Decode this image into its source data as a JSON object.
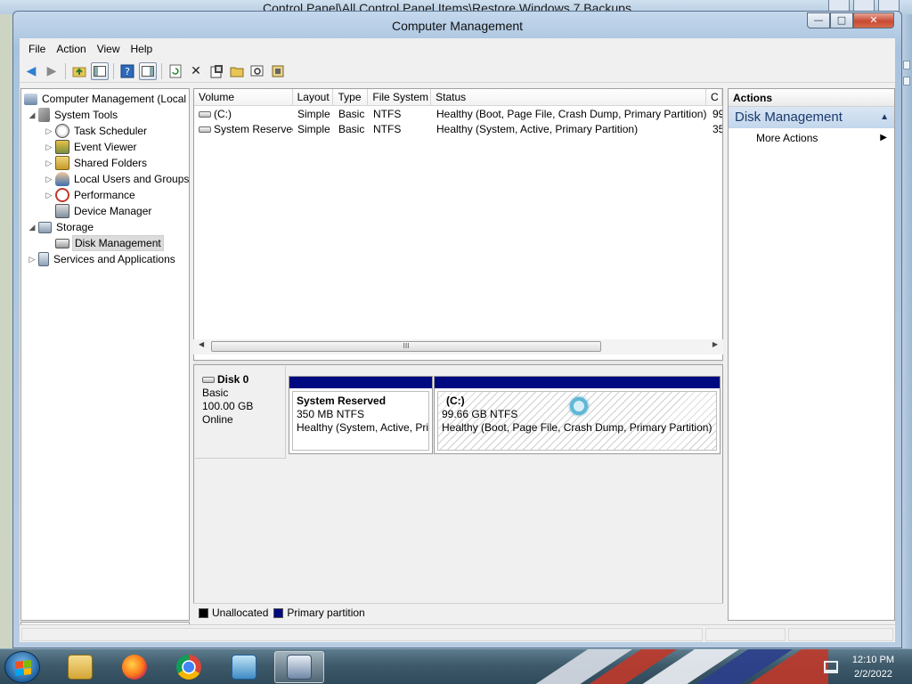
{
  "background_window": {
    "title": "Control Panel\\All Control Panel Items\\Restore Windows 7 Backups"
  },
  "window": {
    "title": "Computer Management",
    "caption_buttons": {
      "minimize": "—",
      "maximize": "□",
      "close": "✕"
    }
  },
  "menu": [
    "File",
    "Action",
    "View",
    "Help"
  ],
  "toolbar_icons": [
    "back-icon",
    "forward-icon",
    "up-folder-icon",
    "show-hide-console-tree-icon",
    "help-icon",
    "show-hide-action-pane-icon",
    "refresh-icon",
    "delete-icon",
    "properties-icon",
    "open-icon",
    "search-icon",
    "disk-properties-icon"
  ],
  "tree": {
    "items": [
      {
        "label": "Computer Management (Local",
        "level": 0,
        "expander": ""
      },
      {
        "label": "System Tools",
        "level": 1,
        "expander": "◢"
      },
      {
        "label": "Task Scheduler",
        "level": 2,
        "expander": "▷"
      },
      {
        "label": "Event Viewer",
        "level": 2,
        "expander": "▷"
      },
      {
        "label": "Shared Folders",
        "level": 2,
        "expander": "▷"
      },
      {
        "label": "Local Users and Groups",
        "level": 2,
        "expander": "▷"
      },
      {
        "label": "Performance",
        "level": 2,
        "expander": "▷"
      },
      {
        "label": "Device Manager",
        "level": 2,
        "expander": ""
      },
      {
        "label": "Storage",
        "level": 1,
        "expander": "◢"
      },
      {
        "label": "Disk Management",
        "level": 2,
        "expander": "",
        "selected": true
      },
      {
        "label": "Services and Applications",
        "level": 1,
        "expander": "▷"
      }
    ]
  },
  "volume_list": {
    "columns": [
      "Volume",
      "Layout",
      "Type",
      "File System",
      "Status",
      "C"
    ],
    "rows": [
      {
        "volume": "(C:)",
        "layout": "Simple",
        "type": "Basic",
        "fs": "NTFS",
        "status": "Healthy (Boot, Page File, Crash Dump, Primary Partition)",
        "c": "99"
      },
      {
        "volume": "System Reserved",
        "layout": "Simple",
        "type": "Basic",
        "fs": "NTFS",
        "status": "Healthy (System, Active, Primary Partition)",
        "c": "35"
      }
    ]
  },
  "disk": {
    "name": "Disk 0",
    "type": "Basic",
    "size": "100.00 GB",
    "state": "Online",
    "partitions": [
      {
        "name": "System Reserved",
        "size": "350 MB NTFS",
        "status": "Healthy (System, Active, Prin"
      },
      {
        "name": "(C:)",
        "size": "99.66 GB NTFS",
        "status": "Healthy (Boot, Page File, Crash Dump, Primary Partition)"
      }
    ]
  },
  "legend": [
    {
      "label": "Unallocated",
      "color": "#000000"
    },
    {
      "label": "Primary partition",
      "color": "#000a80"
    }
  ],
  "actions": {
    "header": "Actions",
    "section": "Disk Management",
    "items": [
      "More Actions"
    ]
  },
  "taskbar": {
    "time": "12:10 PM",
    "date": "2/2/2022"
  }
}
